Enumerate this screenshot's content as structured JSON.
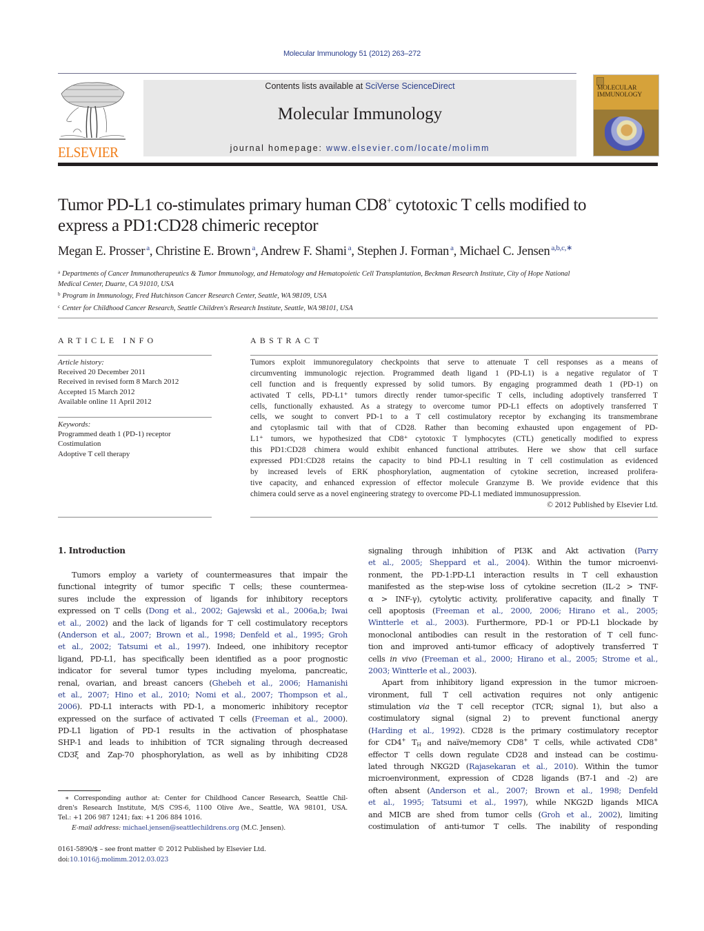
{
  "journal_ref": "Molecular Immunology 51 (2012) 263–272",
  "header": {
    "publisher_logo_text": "ELSEVIER",
    "contents_prefix": "Contents lists available at ",
    "contents_link": "SciVerse ScienceDirect",
    "journal_title": "Molecular Immunology",
    "homepage_prefix": "journal homepage: ",
    "homepage_url": "www.elsevier.com/locate/molimm",
    "cover_title_line1": "MOLECULAR",
    "cover_title_line2": "IMMUNOLOGY",
    "colors": {
      "link": "#2a3e8c",
      "elsevier_orange": "#f07d18",
      "banner_bg": "#e8e8e8"
    }
  },
  "article": {
    "title_line1_pre": "Tumor PD-L1 co-stimulates primary human CD8",
    "title_line1_sup": "+",
    "title_line1_post": " cytotoxic T cells modified to",
    "title_line2": "express a PD1:CD28 chimeric receptor",
    "authors": [
      {
        "name": "Megan E. Prosser",
        "affil": "a",
        "sep": ", "
      },
      {
        "name": "Christine E. Brown",
        "affil": "a",
        "sep": ", "
      },
      {
        "name": "Andrew F. Shami",
        "affil": "a",
        "sep": ", "
      },
      {
        "name": "Stephen J. Forman",
        "affil": "a",
        "sep": ", "
      },
      {
        "name": "Michael C. Jensen",
        "affil": "a,b,c,∗",
        "sep": ""
      }
    ],
    "affiliations": [
      {
        "key": "a",
        "line1": "Departments of Cancer Immunotherapeutics & Tumor Immunology, and Hematology and Hematopoietic Cell Transplantation, Beckman Research Institute, City of Hope National",
        "line2": "Medical Center, Duarte, CA 91010, USA"
      },
      {
        "key": "b",
        "line1": "Program in Immunology, Fred Hutchinson Cancer Research Center, Seattle, WA 98109, USA"
      },
      {
        "key": "c",
        "line1": "Center for Childhood Cancer Research, Seattle Children's Research Institute, Seattle, WA 98101, USA"
      }
    ]
  },
  "article_info": {
    "heading": "ARTICLE INFO",
    "history_label": "Article history:",
    "history": [
      "Received 20 December 2011",
      "Received in revised form 8 March 2012",
      "Accepted 15 March 2012",
      "Available online 11 April 2012"
    ],
    "keywords_label": "Keywords:",
    "keywords": [
      "Programmed death 1 (PD-1) receptor",
      "Costimulation",
      "Adoptive T cell therapy"
    ]
  },
  "abstract": {
    "heading": "ABSTRACT",
    "lines": [
      "Tumors exploit immunoregulatory checkpoints that serve to attenuate T cell responses as a means of",
      "circumventing immunologic rejection. Programmed death ligand 1 (PD-L1) is a negative regulator of T",
      "cell function and is frequently expressed by solid tumors. By engaging programmed death 1 (PD-1) on",
      "activated T cells, PD-L1⁺ tumors directly render tumor-specific T cells, including adoptively transferred T",
      "cells, functionally exhausted. As a strategy to overcome tumor PD-L1 effects on adoptively transferred T",
      "cells, we sought to convert PD-1 to a T cell costimulatory receptor by exchanging its transmembrane",
      "and cytoplasmic tail with that of CD28. Rather than becoming exhausted upon engagement of PD-",
      "L1⁺ tumors, we hypothesized that CD8⁺ cytotoxic T lymphocytes (CTL) genetically modified to express",
      "this PD1:CD28 chimera would exhibit enhanced functional attributes. Here we show that cell surface",
      "expressed PD1:CD28 retains the capacity to bind PD-L1 resulting in T cell costimulation as evidenced",
      "by increased levels of ERK phosphorylation, augmentation of cytokine secretion, increased prolifera-",
      "tive capacity, and enhanced expression of effector molecule Granzyme B. We provide evidence that this",
      "chimera could serve as a novel engineering strategy to overcome PD-L1 mediated immunosuppression."
    ],
    "copyright": "© 2012 Published by Elsevier Ltd."
  },
  "intro": {
    "heading": "1.  Introduction",
    "col1": [
      [
        {
          "t": "Tumors employ a variety of countermeasures that impair the"
        }
      ],
      [
        {
          "t": "functional integrity of tumor specific T cells; these countermea-"
        }
      ],
      [
        {
          "t": "sures include the expression of ligands for inhibitory receptors"
        }
      ],
      [
        {
          "t": "expressed on T cells ("
        },
        {
          "t": "Dong et al., 2002; Gajewski et al., 2006a,b; Iwai",
          "link": true
        }
      ],
      [
        {
          "t": "et al., 2002",
          "link": true
        },
        {
          "t": ") and the lack of ligands for T cell costimulatory receptors"
        }
      ],
      [
        {
          "t": "("
        },
        {
          "t": "Anderson et al., 2007; Brown et al., 1998; Denfeld et al., 1995; Groh",
          "link": true
        }
      ],
      [
        {
          "t": "et al., 2002; Tatsumi et al., 1997",
          "link": true
        },
        {
          "t": "). Indeed, one inhibitory receptor"
        }
      ],
      [
        {
          "t": "ligand, PD-L1, has specifically been identified as a poor prognostic"
        }
      ],
      [
        {
          "t": "indicator for several tumor types including myeloma, pancreatic,"
        }
      ],
      [
        {
          "t": "renal, ovarian, and breast cancers ("
        },
        {
          "t": "Ghebeh et al., 2006; Hamanishi",
          "link": true
        }
      ],
      [
        {
          "t": "et al., 2007; Hino et al., 2010; Nomi et al., 2007; Thompson et al.,",
          "link": true
        }
      ],
      [
        {
          "t": "2006",
          "link": true
        },
        {
          "t": "). PD-L1 interacts with PD-1, a monomeric inhibitory receptor"
        }
      ],
      [
        {
          "t": "expressed on the surface of activated T cells ("
        },
        {
          "t": "Freeman et al., 2000",
          "link": true
        },
        {
          "t": ")."
        }
      ],
      [
        {
          "t": "PD-L1 ligation of PD-1 results in the activation of phosphatase"
        }
      ],
      [
        {
          "t": "SHP-1 and leads to inhibition of TCR signaling through decreased"
        }
      ],
      [
        {
          "t": "CD3ξ and Zap-70 phosphorylation, as well as by inhibiting CD28"
        }
      ]
    ],
    "col2_para1": [
      [
        {
          "t": "signaling through inhibition of PI3K and Akt activation ("
        },
        {
          "t": "Parry",
          "link": true
        }
      ],
      [
        {
          "t": "et al., 2005; Sheppard et al., 2004",
          "link": true
        },
        {
          "t": "). Within the tumor microenvi-"
        }
      ],
      [
        {
          "t": "ronment, the PD-1:PD-L1 interaction results in T cell exhaustion"
        }
      ],
      [
        {
          "t": "manifested as the step-wise loss of cytokine secretion (IL-2 > TNF-"
        }
      ],
      [
        {
          "t": "α > INF-γ), cytolytic activity, proliferative capacity, and finally T"
        }
      ],
      [
        {
          "t": "cell apoptosis ("
        },
        {
          "t": "Freeman et al., 2000, 2006; Hirano et al., 2005;",
          "link": true
        }
      ],
      [
        {
          "t": "Wintterle et al., 2003",
          "link": true
        },
        {
          "t": "). Furthermore, PD-1 or PD-L1 blockade by"
        }
      ],
      [
        {
          "t": "monoclonal antibodies can result in the restoration of T cell func-"
        }
      ],
      [
        {
          "t": "tion and improved anti-tumor efficacy of adoptively transferred T"
        }
      ],
      [
        {
          "t": "cells "
        },
        {
          "t": "in vivo",
          "italic": true
        },
        {
          "t": " ("
        },
        {
          "t": "Freeman et al., 2000; Hirano et al., 2005; Strome et al.,",
          "link": true
        }
      ],
      [
        {
          "t": "2003; Wintterle et al., 2003",
          "link": true
        },
        {
          "t": ")."
        }
      ]
    ],
    "col2_para2": [
      [
        {
          "t": "Apart from inhibitory ligand expression in the tumor microen-"
        }
      ],
      [
        {
          "t": "vironment, full T cell activation requires not only antigenic"
        }
      ],
      [
        {
          "t": "stimulation "
        },
        {
          "t": "via",
          "italic": true
        },
        {
          "t": " the T cell receptor (TCR; signal 1), but also a"
        }
      ],
      [
        {
          "t": "costimulatory signal (signal 2) to prevent functional anergy"
        }
      ],
      [
        {
          "t": "("
        },
        {
          "t": "Harding et al., 1992",
          "link": true
        },
        {
          "t": "). CD28 is the primary costimulatory receptor"
        }
      ],
      [
        {
          "t": "for CD4"
        },
        {
          "t": "+",
          "sup": true
        },
        {
          "t": " T"
        },
        {
          "t": "H",
          "sub": true
        },
        {
          "t": " and naïve/memory CD8"
        },
        {
          "t": "+",
          "sup": true
        },
        {
          "t": " T cells, while activated CD8"
        },
        {
          "t": "+",
          "sup": true
        }
      ],
      [
        {
          "t": "effector T cells down regulate CD28 and instead can be costimu-"
        }
      ],
      [
        {
          "t": "lated through NKG2D ("
        },
        {
          "t": "Rajasekaran et al., 2010",
          "link": true
        },
        {
          "t": "). Within the tumor"
        }
      ],
      [
        {
          "t": "microenvironment, expression of CD28 ligands (B7-1 and -2) are"
        }
      ],
      [
        {
          "t": "often absent ("
        },
        {
          "t": "Anderson et al., 2007; Brown et al., 1998; Denfeld",
          "link": true
        }
      ],
      [
        {
          "t": "et al., 1995; Tatsumi et al., 1997",
          "link": true
        },
        {
          "t": "), while NKG2D ligands MICA"
        }
      ],
      [
        {
          "t": "and MICB are shed from tumor cells ("
        },
        {
          "t": "Groh et al., 2002",
          "link": true
        },
        {
          "t": "), limiting"
        }
      ],
      [
        {
          "t": "costimulation of anti-tumor T cells. The inability of responding"
        }
      ]
    ]
  },
  "footnote": {
    "line1": "∗ Corresponding author at: Center for Childhood Cancer Research, Seattle Chil-",
    "line2": "dren's Research Institute, M/S C9S-6, 1100 Olive Ave., Seattle, WA 98101, USA.",
    "line3": "Tel.: +1 206 987 1241; fax: +1 206 884 1016.",
    "email_label": "E-mail address:",
    "email": "michael.jensen@seattlechildrens.org",
    "email_suffix": " (M.C. Jensen)."
  },
  "issn": {
    "line1": "0161-5890/$ – see front matter © 2012 Published by Elsevier Ltd.",
    "doi_prefix": "doi:",
    "doi": "10.1016/j.molimm.2012.03.023"
  }
}
